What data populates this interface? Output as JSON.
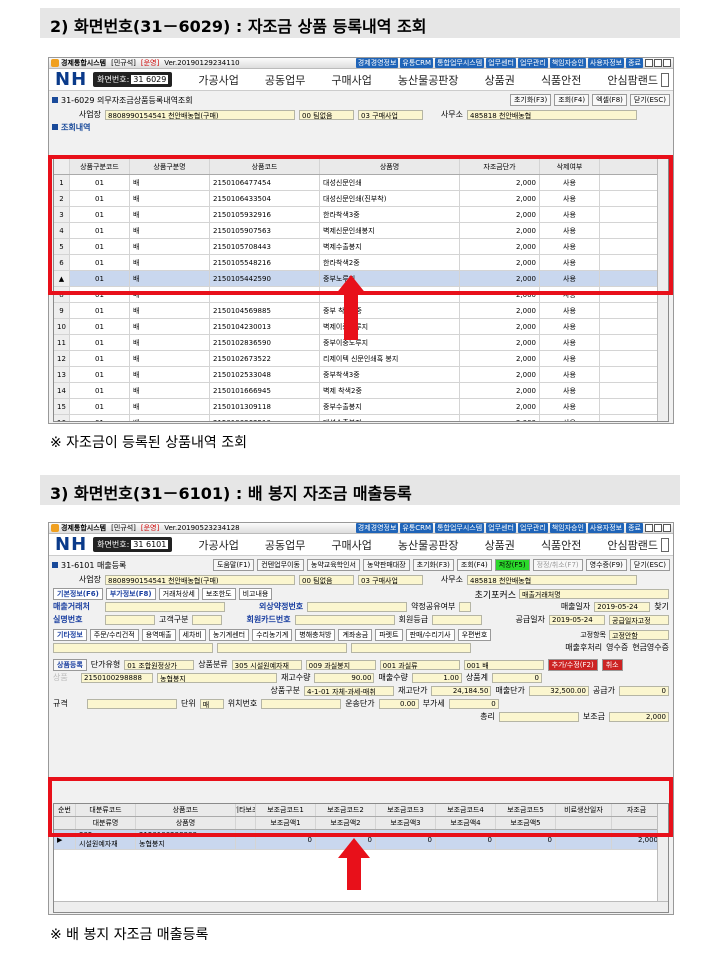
{
  "heading1": "2) 화면번호(31－6029) : 자조금 상품 등록내역 조회",
  "caption1": "※ 자조금이 등록된 상품내역 조회",
  "heading2": "3) 화면번호(31－6101) : 배 봉지 자조금 매출등록",
  "caption2": "※ 배 봉지 자조금 매출등록",
  "w1": {
    "app": "경제통합시스템",
    "role": "[민규석]",
    "mode": "[운영]",
    "ver": "Ver.20190129234110",
    "screen_no": "31 6029",
    "screen_title": "31-6029 의무자조금상품등록내역조회"
  },
  "w2": {
    "app": "경제통합시스템",
    "role": "[민규석]",
    "mode": "[운영]",
    "ver": "Ver.20190523234128",
    "screen_no": "31 6101",
    "screen_title": "31-6101 매출등록"
  },
  "links": [
    "경제경영정보",
    "유통CRM",
    "통합업무시스템",
    "업무센터",
    "업무관리",
    "책임자승인",
    "사용자정보",
    "종료"
  ],
  "menu": {
    "logo": "NH",
    "screen_label": "화면번호:",
    "items": [
      "가공사업",
      "공동업무",
      "구매사업",
      "농산물공판장",
      "상품권",
      "식품안전",
      "안심팜랜드"
    ]
  },
  "w1btns": [
    "초기화(F3)",
    "조회(F4)",
    "엑셀(F8)",
    "닫기(ESC)"
  ],
  "w1form": {
    "biz_label": "사업장",
    "biz_value": "8808990154541 천안배농협(구매)",
    "team": "00 팀없음",
    "div": "03 구매사업",
    "office_label": "사무소",
    "office_value": "485818 천안배농협",
    "section": "조회내역"
  },
  "grid1": {
    "headers": [
      "상품구분코드",
      "상품구분명",
      "상품코드",
      "상품명",
      "자조금단가",
      "삭제여부"
    ],
    "rows": [
      [
        "1",
        "01",
        "배",
        "2150106477454",
        "대성신문인쇄",
        "2,000",
        "사용"
      ],
      [
        "2",
        "01",
        "배",
        "2150106433504",
        "대성신문인쇄(진부착)",
        "2,000",
        "사용"
      ],
      [
        "3",
        "01",
        "배",
        "2150105932916",
        "한라착색3중",
        "2,000",
        "사용"
      ],
      [
        "4",
        "01",
        "배",
        "2150105907563",
        "벽제신문인쇄봉지",
        "2,000",
        "사용"
      ],
      [
        "5",
        "01",
        "배",
        "2150105708443",
        "벽제수출봉지",
        "2,000",
        "사용"
      ],
      [
        "6",
        "01",
        "배",
        "2150105548216",
        "한라착색2중",
        "2,000",
        "사용"
      ],
      [
        "▲",
        "01",
        "배",
        "2150105442590",
        "중부노루지",
        "2,000",
        "사용"
      ],
      [
        "8",
        "01",
        "배",
        "",
        "",
        "2,000",
        "사용"
      ],
      [
        "9",
        "01",
        "배",
        "2150104569885",
        "중부 착색2중",
        "2,000",
        "사용"
      ],
      [
        "10",
        "01",
        "배",
        "2150104230013",
        "벽제이중노루지",
        "2,000",
        "사용"
      ],
      [
        "11",
        "01",
        "배",
        "2150102836590",
        "중부이중노루지",
        "2,000",
        "사용"
      ],
      [
        "12",
        "01",
        "배",
        "2150102673522",
        "리제이텍 신문인쇄흑 봉지",
        "2,000",
        "사용"
      ],
      [
        "13",
        "01",
        "배",
        "2150102533048",
        "중부착색3중",
        "2,000",
        "사용"
      ],
      [
        "14",
        "01",
        "배",
        "2150101666945",
        "벽제 착색2중",
        "2,000",
        "사용"
      ],
      [
        "15",
        "01",
        "배",
        "2150101309118",
        "중부수출봉지",
        "2,000",
        "사용"
      ],
      [
        "16",
        "01",
        "배",
        "2150100362510",
        "대성수출봉지",
        "2,000",
        "사용"
      ]
    ]
  },
  "w2btns": [
    "도움말(F1)",
    "컨텐업무이동",
    "농약교육학인서",
    "농약판매대장",
    "초기화(F3)",
    "조회(F4)",
    "저장(F5)",
    "정정/취소(F7)",
    "영수증(F9)",
    "닫기(ESC)"
  ],
  "w2form": {
    "biz_label": "사업장",
    "biz_value": "8808990154541 천안배농협(구매)",
    "team": "00 팀없음",
    "div": "03 구매사업",
    "office_label": "사무소",
    "office_value": "485818 천안배농협",
    "tabs": [
      "기본정보(F6)",
      "부가정보(F8)",
      "거래처상세",
      "보조한도",
      "비고내용"
    ],
    "init_focus_label": "초기포커스",
    "init_focus_value": "매출거래처명",
    "cust_label": "매출거래처",
    "realname_label": "실명번호",
    "grade_label": "고객구분",
    "ext_label": "외상약정번호",
    "card_label": "회원카드번호",
    "agree_label": "약정공유여부",
    "member_label": "회원등급",
    "sales_date_label": "매출일자",
    "sales_date": "2019-05-24",
    "supply_label": "공급일자",
    "supply_date": "2019-05-24",
    "find_label": "찾기",
    "supply_by": "공급일자고정",
    "tabs2": [
      "기타정보",
      "주문/수리건적",
      "용역매출",
      "세차비",
      "농기계센터",
      "수리농기계",
      "병해충처방",
      "계좌송금",
      "파렛트",
      "판매/수리기사",
      "우편번호"
    ],
    "fixed_label": "고정항목",
    "fixed_value": "고정안함",
    "receipt": "영수증",
    "cash_receipt": "현금영수증",
    "issue": "매출후처리"
  },
  "w2detail": {
    "btn": "상품등록",
    "unit_type": "단가유형",
    "unit_type_val": "01 조합원정상가",
    "cls": "상품분류",
    "cls_val": "305 시설원예자재",
    "grp": "009 과실봉지",
    "grp2": "001 과실류",
    "grp3": "001 배",
    "add_btn": "추가/수정(F2)",
    "del_btn": "취소",
    "item_label": "상품",
    "item_code": "2150100298888",
    "item_name": "농협봉지",
    "stock_label": "재고수량",
    "stock": "90.00",
    "qty_label": "매출수량",
    "qty": "1.00",
    "amount_label": "상품계",
    "amount": "0",
    "price_label": "재고단가",
    "price": "24,184.50",
    "sale_price_label": "매출단가",
    "sale_price": "32,500.00",
    "supply_amt_label": "공급가",
    "supply_amt": "0",
    "spec_label": "규격",
    "unit_label": "단위",
    "unit_val": "매",
    "loc_label": "위치번호",
    "vat_label": "부가세",
    "vat": "0",
    "freight_label": "운송단가",
    "freight": "0.00",
    "total_label": "총리",
    "subsidy_label": "보조금",
    "subsidy": "2,000",
    "tax_class": "상품구분",
    "tax_val": "4-1-01 자체-과세-매취"
  },
  "grid2": {
    "headers": [
      "순번",
      "대분류코드",
      "상품코드",
      "기타보조",
      "보조금코드1",
      "보조금코드2",
      "보조금코드3",
      "보조금코드4",
      "보조금코드5",
      "비료생산일자",
      "자조금"
    ],
    "headers2": [
      "",
      "대분류명",
      "상품명",
      "",
      "보조금액1",
      "보조금액2",
      "보조금액3",
      "보조금액4",
      "보조금액5",
      "",
      ""
    ],
    "row": {
      "marker": "▶",
      "cat_code": "305",
      "cat_name": "시설원예자재",
      "item_code": "2150100298888",
      "item_name": "농협봉지",
      "a1": "0",
      "a2": "0",
      "a3": "0",
      "a4": "0",
      "a5": "0",
      "self_fund": "2,000"
    }
  },
  "colors": {
    "highlight": "#e8101a",
    "input_bg": "#fbf6cf",
    "accent": "#1a3fa0",
    "save_btn": "#2bd82b"
  }
}
